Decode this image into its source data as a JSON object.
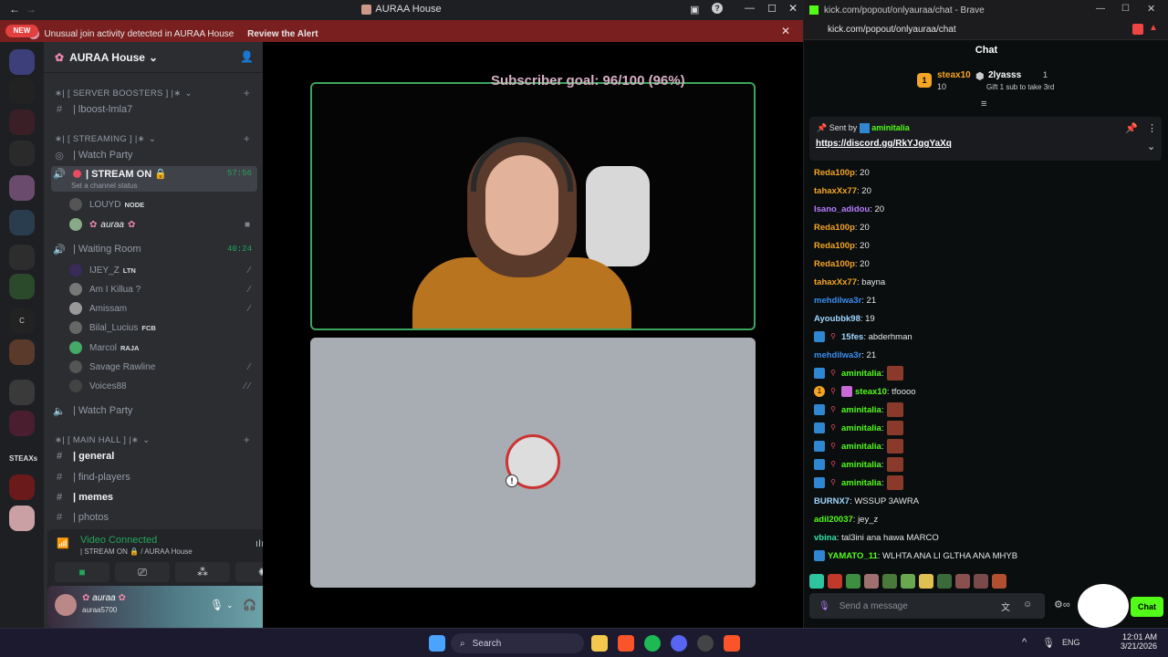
{
  "discord": {
    "window_title": "AURAA House",
    "alert_text": "Unusual join activity detected in AURAA House",
    "alert_link": "Review the Alert",
    "new_pill": "NEW",
    "steax_label": "STEAXs",
    "server_name": "AURAA House",
    "categories": {
      "boosters": "∗| [ SERVER BOOSTERS ] |∗",
      "streaming": "∗| [ STREAMING ] |∗",
      "main_hall": "∗| [ MAIN HALL ] |∗"
    },
    "channels": {
      "boost": "| lboost-lmla7",
      "watch_party_1": "| Watch Party",
      "stream_on": "| STREAM ON 🔒",
      "stream_status": "Set a channel status",
      "stream_time": "57:56",
      "waiting_room": "| Waiting Room",
      "waiting_time": "40:24",
      "watch_party_2": "| Watch Party",
      "general": "| general",
      "find_players": "| find-players",
      "memes": "| memes",
      "photos": "| photos"
    },
    "stream_users": [
      {
        "name": "LOUYD",
        "badge": "NODE"
      },
      {
        "name": "auraa",
        "badge": ""
      }
    ],
    "waiting_users": [
      {
        "name": "IJEY_Z",
        "badge": "LTN"
      },
      {
        "name": "Am I Killua ?",
        "badge": ""
      },
      {
        "name": "Amissam",
        "badge": ""
      },
      {
        "name": "Bilal_Lucius",
        "badge": "FCB"
      },
      {
        "name": "Marcol",
        "badge": "RAJA"
      },
      {
        "name": "Savage Rawline",
        "badge": ""
      },
      {
        "name": "Voices88",
        "badge": ""
      }
    ],
    "voice_panel": {
      "status": "Video Connected",
      "location": "| STREAM ON 🔒 / AURAA House"
    },
    "user_panel": {
      "display_name": "auraa",
      "username": "auraa5700"
    },
    "subscriber_goal": "Subscriber goal: 96/100 (96%)",
    "colors": {
      "accent": "#23a55a",
      "alert": "#7a1f1f"
    }
  },
  "browser": {
    "tab_title": "kick.com/popout/onlyauraa/chat - Brave",
    "url": "kick.com/popout/onlyauraa/chat",
    "chat_header": "Chat",
    "gifters": {
      "first": {
        "name": "steax10",
        "count": "10",
        "rank": "1"
      },
      "second": {
        "name": "2lyasss",
        "count": "1"
      },
      "gift_hint": "Gift 1 sub to take 3rd"
    },
    "pinned": {
      "sent_by_label": "Sent by",
      "sender": "aminitalia",
      "link": "https://discord.gg/RkYJggYaXq"
    },
    "messages": [
      {
        "user": "Reda100p",
        "text": ": 20",
        "color": "#f5a524",
        "badges": 0,
        "emote": 0
      },
      {
        "user": "tahaxXx77",
        "text": ": 20",
        "color": "#f5a524",
        "badges": 0,
        "emote": 0
      },
      {
        "user": "Isano_adidou",
        "text": ": 20",
        "color": "#b77cff",
        "badges": 0,
        "emote": 0
      },
      {
        "user": "Reda100p",
        "text": ": 20",
        "color": "#f5a524",
        "badges": 0,
        "emote": 0
      },
      {
        "user": "Reda100p",
        "text": ": 20",
        "color": "#f5a524",
        "badges": 0,
        "emote": 0
      },
      {
        "user": "Reda100p",
        "text": ": 20",
        "color": "#f5a524",
        "badges": 0,
        "emote": 0
      },
      {
        "user": "tahaxXx77",
        "text": ": bayna",
        "color": "#f5a524",
        "badges": 0,
        "emote": 0
      },
      {
        "user": "mehdilwa3r",
        "text": ": 21",
        "color": "#3b8ef0",
        "badges": 0,
        "emote": 0
      },
      {
        "user": "Ayoubbk98",
        "text": ": 19",
        "color": "#9fd6ff",
        "badges": 0,
        "emote": 0
      },
      {
        "user": "15fes",
        "text": ": abderhman",
        "color": "#9fd6ff",
        "badges": 2,
        "emote": 0
      },
      {
        "user": "mehdilwa3r",
        "text": ": 21",
        "color": "#3b8ef0",
        "badges": 0,
        "emote": 0
      },
      {
        "user": "aminitalia",
        "text": ":",
        "color": "#53fc18",
        "badges": 2,
        "emote": 1
      },
      {
        "user": "steax10",
        "text": ": tfoooo",
        "color": "#53fc18",
        "badges": 3,
        "emote": 0
      },
      {
        "user": "aminitalia",
        "text": ":",
        "color": "#53fc18",
        "badges": 2,
        "emote": 1
      },
      {
        "user": "aminitalia",
        "text": ":",
        "color": "#53fc18",
        "badges": 2,
        "emote": 1
      },
      {
        "user": "aminitalia",
        "text": ":",
        "color": "#53fc18",
        "badges": 2,
        "emote": 1
      },
      {
        "user": "aminitalia",
        "text": ":",
        "color": "#53fc18",
        "badges": 2,
        "emote": 1
      },
      {
        "user": "aminitalia",
        "text": ":",
        "color": "#53fc18",
        "badges": 2,
        "emote": 1
      },
      {
        "user": "BURNX7",
        "text": ": WSSUP 3AWRA",
        "color": "#9fd6ff",
        "badges": 0,
        "emote": 0
      },
      {
        "user": "adil20037",
        "text": ": jey_z",
        "color": "#53fc18",
        "badges": 0,
        "emote": 0
      },
      {
        "user": "vbina",
        "text": ": tal3ini ana hawa MARCO",
        "color": "#2ee6a6",
        "badges": 0,
        "emote": 0
      },
      {
        "user": "YAMATO_11",
        "text": ": WLHTA ANA LI GLTHA ANA MHYB",
        "color": "#53fc18",
        "badges": 1,
        "emote": 0
      }
    ],
    "send_placeholder": "Send a message",
    "chat_button": "Chat"
  },
  "taskbar": {
    "search_label": "Search",
    "lang": "ENG",
    "time": "12:01 AM",
    "date": "3/21/2026"
  }
}
